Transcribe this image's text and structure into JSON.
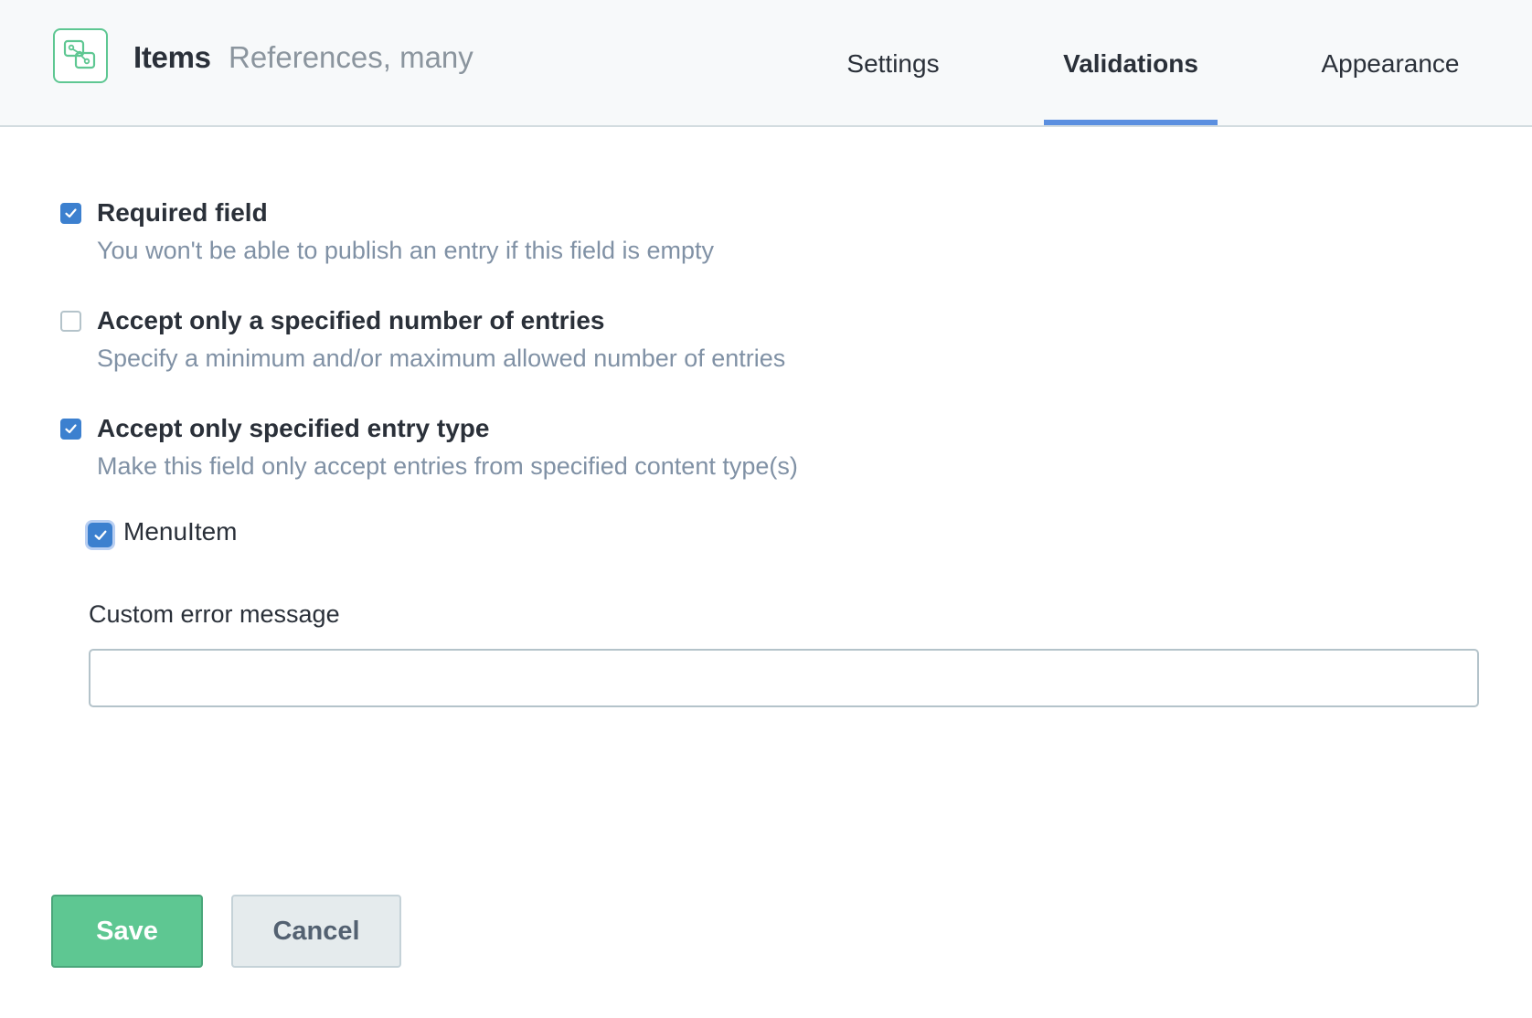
{
  "header": {
    "field_name": "Items",
    "field_type": "References, many",
    "tabs": [
      {
        "label": "Settings",
        "active": false
      },
      {
        "label": "Validations",
        "active": true
      },
      {
        "label": "Appearance",
        "active": false
      }
    ]
  },
  "validations": [
    {
      "title": "Required field",
      "description": "You won't be able to publish an entry if this field is empty",
      "checked": true
    },
    {
      "title": "Accept only a specified number of entries",
      "description": "Specify a minimum and/or maximum allowed number of entries",
      "checked": false
    },
    {
      "title": "Accept only specified entry type",
      "description": "Make this field only accept entries from specified content type(s)",
      "checked": true
    }
  ],
  "content_types": [
    {
      "label": "MenuItem",
      "checked": true
    }
  ],
  "custom_error": {
    "label": "Custom error message",
    "value": "",
    "placeholder": ""
  },
  "buttons": {
    "save": "Save",
    "cancel": "Cancel"
  },
  "colors": {
    "accent_blue": "#3c80cf",
    "tab_underline": "#5b8fe0",
    "save_green": "#5ec792",
    "muted_text": "#8091a5"
  },
  "icons": {
    "field_type_icon": "references-icon",
    "checkmark": "check-icon"
  }
}
